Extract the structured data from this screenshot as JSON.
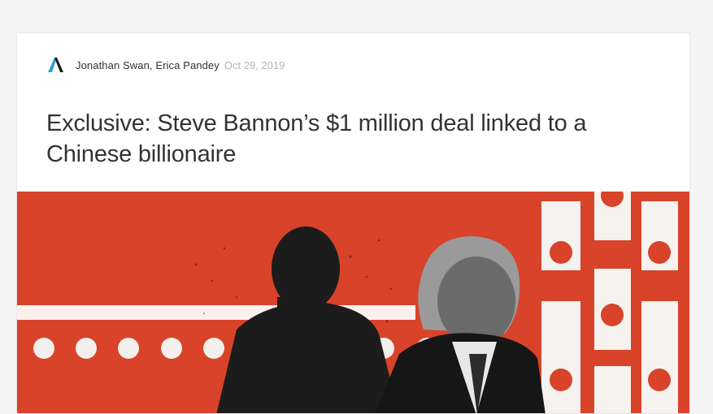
{
  "article": {
    "publisher_logo_icon": "axios-logo-icon",
    "authors": "Jonathan Swan, Erica Pandey",
    "date": "Oct 29, 2019",
    "headline": "Exclusive: Steve Bannon’s $1 million deal linked to a Chinese billionaire",
    "hero_image": "illustration-two-men-red-background"
  },
  "colors": {
    "hero_background": "#d8432a",
    "text_primary": "#333333",
    "text_muted": "#b5b5b5",
    "logo_dark": "#1a1a1a",
    "logo_accent": "#2aa0d8"
  }
}
